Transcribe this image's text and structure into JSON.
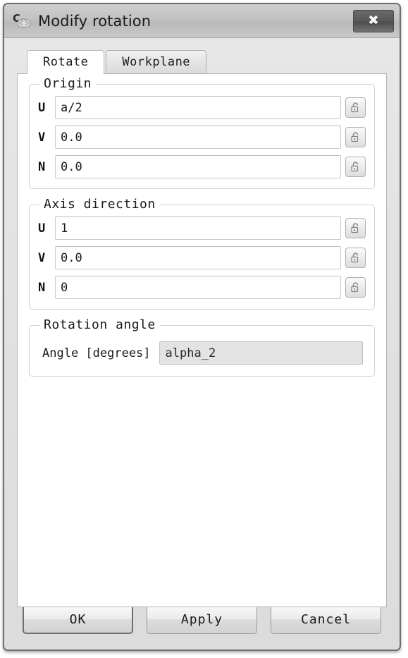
{
  "window": {
    "title": "Modify rotation",
    "icon": "rotation-app-icon",
    "close_label": "✖"
  },
  "tabs": [
    {
      "label": "Rotate",
      "active": true
    },
    {
      "label": "Workplane",
      "active": false
    }
  ],
  "groups": {
    "origin": {
      "title": "Origin",
      "fields": [
        {
          "label": "U",
          "value": "a/2",
          "lock_icon": "padlock-open-icon"
        },
        {
          "label": "V",
          "value": "0.0",
          "lock_icon": "padlock-open-icon"
        },
        {
          "label": "N",
          "value": "0.0",
          "lock_icon": "padlock-open-icon"
        }
      ]
    },
    "axis_direction": {
      "title": "Axis direction",
      "fields": [
        {
          "label": "U",
          "value": "1",
          "lock_icon": "padlock-open-icon"
        },
        {
          "label": "V",
          "value": "0.0",
          "lock_icon": "padlock-open-icon"
        },
        {
          "label": "N",
          "value": "0",
          "lock_icon": "padlock-open-icon"
        }
      ]
    },
    "rotation_angle": {
      "title": "Rotation angle",
      "angle_label": "Angle [degrees]",
      "angle_value": "alpha_2"
    }
  },
  "footer": {
    "ok": "OK",
    "apply": "Apply",
    "cancel": "Cancel"
  },
  "colors": {
    "window_bg": "#e2e2e2",
    "titlebar": "#c2c2c2",
    "panel_bg": "#ffffff",
    "border": "#6e6e6e",
    "close_btn": "#5a5a5a",
    "disabled_field": "#e3e3e3"
  }
}
